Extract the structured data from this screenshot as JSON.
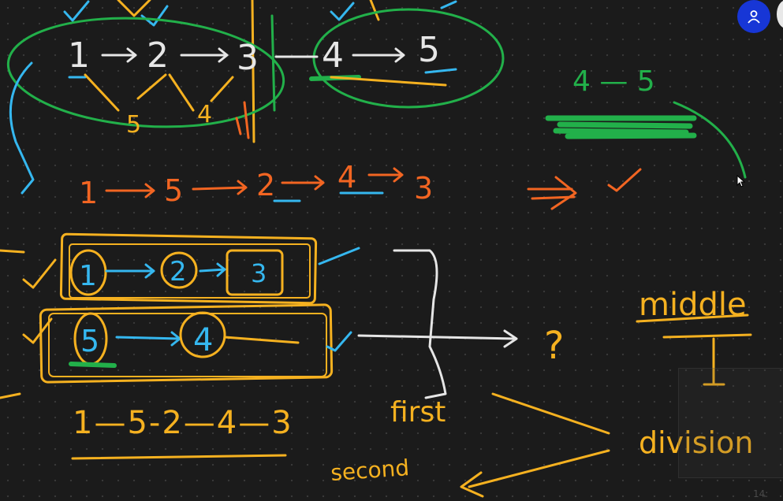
{
  "colors": {
    "background": "#1b1b1b",
    "white_ink": "#e6e6e6",
    "orange_ink": "#f26522",
    "yellow_ink": "#f5b120",
    "cyan_ink": "#35b7ef",
    "green_ink": "#22b04a",
    "accent_blue": "#1736d6"
  },
  "icons": {
    "avatar": "user-icon",
    "cursor": "mouse-pointer-icon"
  },
  "top_list": {
    "nodes": [
      "1",
      "2",
      "3",
      "4",
      "5"
    ],
    "under_labels": [
      "5",
      "4"
    ]
  },
  "green_note": "4 — 5",
  "orange_list": [
    "1",
    "5",
    "2",
    "4",
    "3"
  ],
  "box_first_list": [
    "1",
    "2",
    "3"
  ],
  "box_second_list": [
    "5",
    "4"
  ],
  "question_mark": "?",
  "merged_result": "1—5-2—4—3",
  "labels": {
    "middle": "middle",
    "division": "division",
    "first": "first",
    "second": "second"
  },
  "timecode": "14:"
}
